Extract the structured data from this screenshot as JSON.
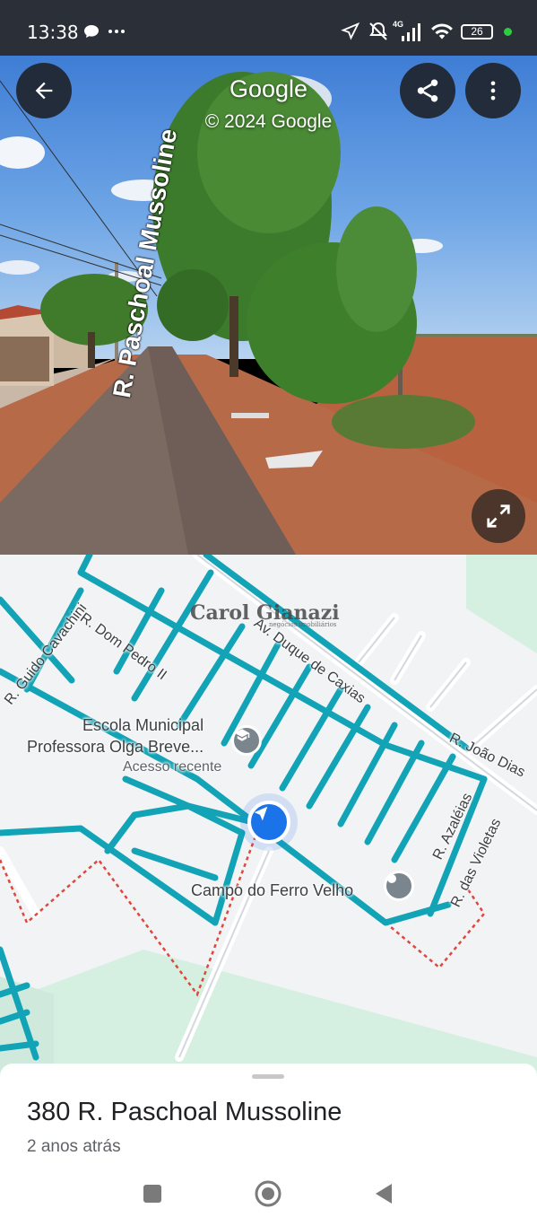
{
  "status_bar": {
    "time": "13:38",
    "battery": "26",
    "network": "4G",
    "icons": [
      "chat-bubble-icon",
      "more-dots-icon",
      "location-arrow-icon",
      "mute-icon",
      "signal-icon",
      "wifi-icon",
      "battery-icon",
      "active-dot-icon"
    ]
  },
  "streetview": {
    "brand": "Google",
    "copyright": "© 2024 Google",
    "street_label": "R. Paschoal Mussoline",
    "buttons": [
      "back-arrow-icon",
      "share-icon",
      "more-vert-icon",
      "expand-icon"
    ]
  },
  "map": {
    "watermark": "Carol Gianazi",
    "watermark_sub": "negócios imobiliários",
    "streets": [
      "R. Guido Cavachini",
      "R. Dom Pedro II",
      "Av. Duque de Caxias",
      "R. João Dias",
      "R. Azaléias",
      "R. das Violetas"
    ],
    "school_name_line1": "Escola Municipal",
    "school_name_line2": "Professora Olga Breve...",
    "school_sub": "Acesso recente",
    "place_poi": "Campo do Ferro Velho",
    "colors": {
      "road_highlight": "#12a4b6",
      "boundary": "#e0473c",
      "park": "#d5efe1",
      "accent_blue": "#1a73e8"
    }
  },
  "sheet": {
    "title": "380 R. Paschoal Mussoline",
    "subtitle": "2 anos atrás"
  },
  "nav": [
    "recents-square-icon",
    "home-circle-icon",
    "back-triangle-icon"
  ]
}
